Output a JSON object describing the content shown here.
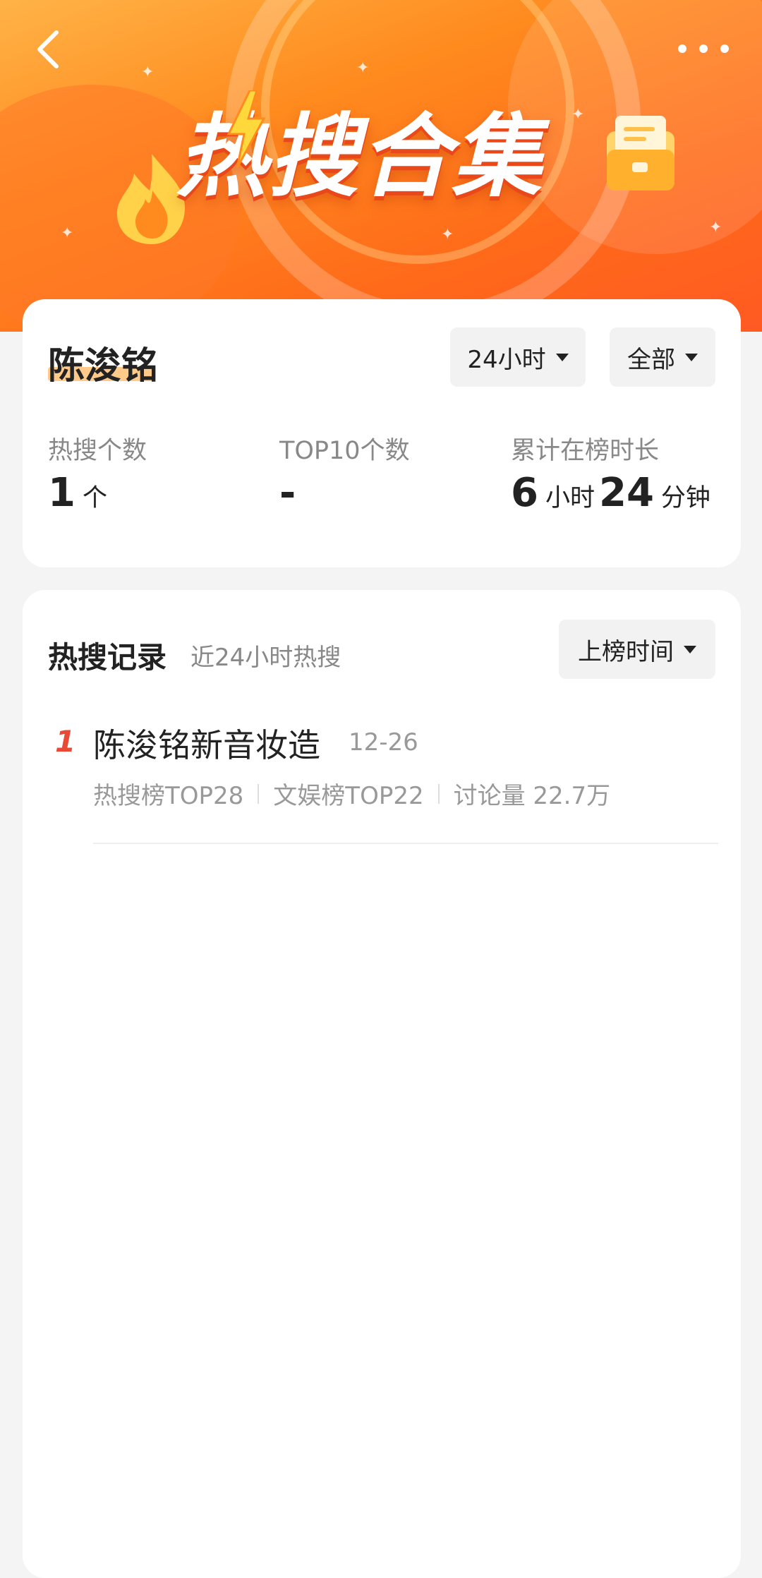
{
  "header": {
    "title": "热搜合集",
    "back_icon": "chevron-left-icon",
    "more_icon": "more-dots-icon"
  },
  "summary": {
    "name": "陈浚铭",
    "time_filter": "24小时",
    "category_filter": "全部",
    "stats": [
      {
        "label": "热搜个数",
        "value": "1",
        "unit": "个"
      },
      {
        "label": "TOP10个数",
        "value": "-"
      },
      {
        "label": "累计在榜时长",
        "hours": "6",
        "hours_unit": "小时",
        "minutes": "24",
        "minutes_unit": "分钟"
      }
    ]
  },
  "records": {
    "title": "热搜记录",
    "subtitle": "近24小时热搜",
    "sort_label": "上榜时间",
    "items": [
      {
        "rank": "1",
        "title": "陈浚铭新音妆造",
        "date": "12-26",
        "hot_rank": "热搜榜TOP28",
        "ent_rank": "文娱榜TOP22",
        "discussion": "讨论量 22.7万"
      }
    ]
  },
  "colors": {
    "brand_orange": "#ff6a1a",
    "rank_red": "#e84a36",
    "highlight": "#ffc98a"
  }
}
